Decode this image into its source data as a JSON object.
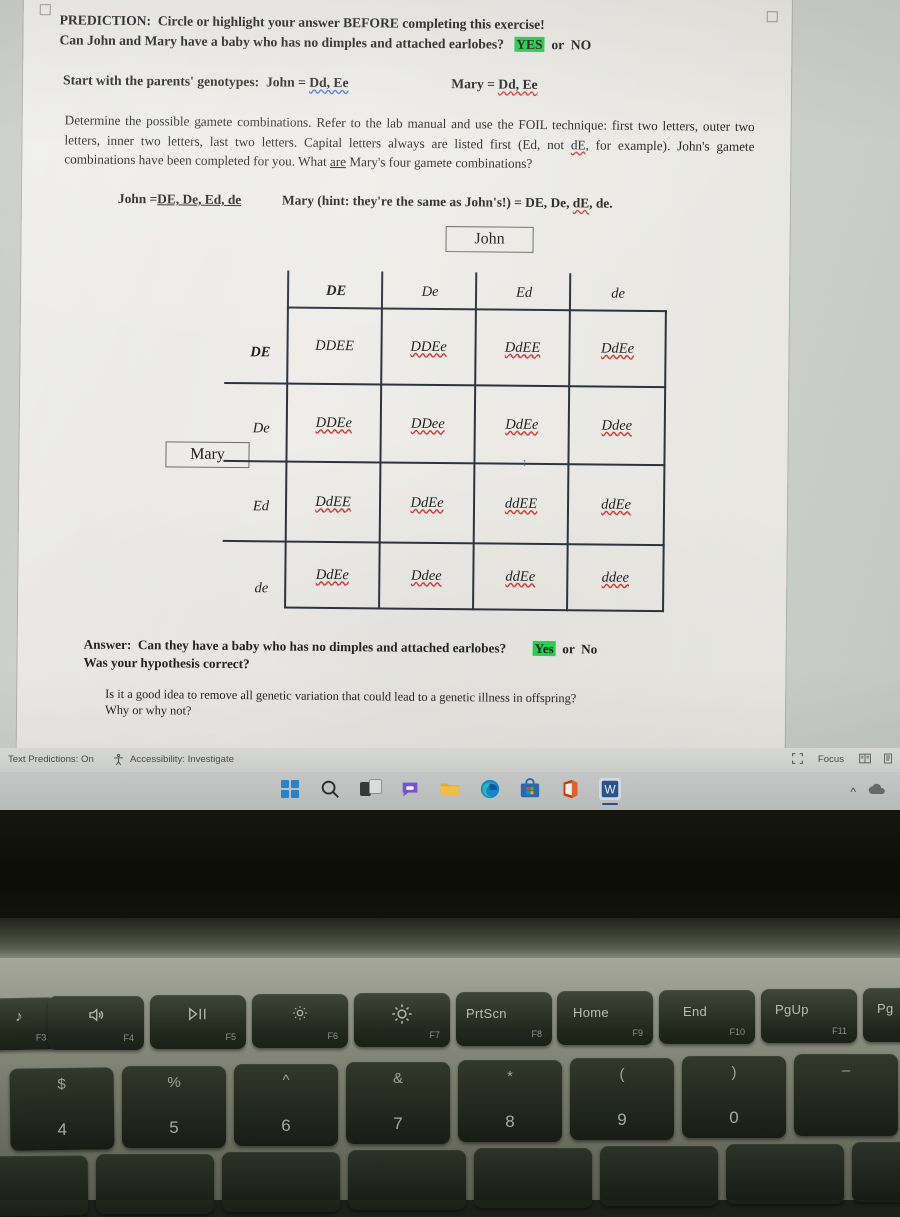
{
  "document": {
    "prediction_label": "PREDICTION:",
    "prediction_text": "Circle or highlight your answer BEFORE completing this exercise!",
    "question_line": "Can John and Mary have a baby who has no dimples and attached earlobes?",
    "answer_yes": "YES",
    "answer_or": "or",
    "answer_no": "NO",
    "genotypes_lead": "Start with the parents' genotypes:",
    "john_geno_label": "John =",
    "john_geno_value": "Dd,  Ee",
    "mary_geno_label": "Mary =",
    "mary_geno_value": "Dd,  Ee",
    "instructions": "Determine the possible gamete combinations.  Refer to the lab manual and use the FOIL technique:  first two letters, outer two letters, inner two letters, last two letters.  Capital letters always are listed first (Ed, not dE, for example).  John's gamete combinations have been completed for you.  What are Mary's four gamete combinations?",
    "instructions_part1": "Determine the possible gamete combinations.  Refer to the lab manual and use the FOIL technique:  first two letters, outer two letters, inner two letters, last two letters.  Capital letters always are listed first (Ed, not ",
    "instructions_de": "dE",
    "instructions_part2": ", for example).  John's gamete combinations have been completed for you.  What ",
    "instructions_are": "are",
    "instructions_part3": " Mary's four gamete combinations?",
    "john_gametes_label": "John =",
    "john_gametes_value": "DE, De, Ed, de",
    "mary_hint_label": "Mary (hint:  they're the same as John's!) =",
    "mary_gametes_prefix": "DE, De, ",
    "mary_gametes_de": "dE",
    "mary_gametes_suffix": ", de.",
    "answer_label": "Answer:",
    "answer_question": "Can they have a baby who has no dimples and attached earlobes?",
    "answer2_yes": "Yes",
    "answer2_or": "or",
    "answer2_no": "No",
    "hypothesis_line": "Was your hypothesis correct?",
    "reflection_line1": "Is it a good idea to remove all genetic variation that could lead to a genetic illness in offspring?",
    "reflection_line2": "Why or why not?"
  },
  "punnett": {
    "top_parent_label": "John",
    "side_parent_label": "Mary",
    "col_headers": [
      "DE",
      "De",
      "Ed",
      "de"
    ],
    "row_headers": [
      "DE",
      "De",
      "Ed",
      "de"
    ],
    "rows": [
      [
        "DDEE",
        "DDEe",
        "DdEE",
        "DdEe"
      ],
      [
        "DDEe",
        "DDee",
        "DdEe",
        "Ddee"
      ],
      [
        "DdEE",
        "DdEe",
        "ddEE",
        "ddEe"
      ],
      [
        "DdEe",
        "Ddee",
        "ddEe",
        "ddee"
      ]
    ]
  },
  "statusbar": {
    "text_predictions": "Text Predictions: On",
    "accessibility": "Accessibility: Investigate",
    "focus": "Focus",
    "view_read_icon": "read-mode-icon",
    "view_print_icon": "print-layout-icon",
    "accessibility_icon": "accessibility-person-icon",
    "focus_icon": "focus-icon"
  },
  "taskbar": {
    "items": [
      {
        "name": "start-button",
        "icon": "windows-logo-icon"
      },
      {
        "name": "search-button",
        "icon": "search-icon"
      },
      {
        "name": "task-view-button",
        "icon": "task-view-icon"
      },
      {
        "name": "chat-button",
        "icon": "chat-bubble-icon"
      },
      {
        "name": "file-explorer-button",
        "icon": "folder-icon"
      },
      {
        "name": "edge-button",
        "icon": "edge-browser-icon"
      },
      {
        "name": "microsoft-store-button",
        "icon": "store-bag-icon"
      },
      {
        "name": "office-button",
        "icon": "office-icon"
      },
      {
        "name": "word-button",
        "icon": "word-document-icon"
      }
    ],
    "tray": [
      {
        "name": "show-hidden-icons-button",
        "icon": "chevron-up-icon",
        "glyph": "∧"
      },
      {
        "name": "onedrive-button",
        "icon": "cloud-icon"
      }
    ]
  },
  "keyboard": {
    "function_row": [
      {
        "main": "",
        "sub": "F3",
        "glyph": "⦾",
        "name": "key-f3"
      },
      {
        "main": "",
        "sub": "F4",
        "glyph": "🔊",
        "name": "key-f4-volume"
      },
      {
        "main": "",
        "sub": "F5",
        "glyph": "▷❘❘",
        "name": "key-f5-play-pause"
      },
      {
        "main": "",
        "sub": "F6",
        "glyph": "☼",
        "name": "key-f6-brightness-down"
      },
      {
        "main": "",
        "sub": "F7",
        "glyph": "☀",
        "name": "key-f7-brightness-up"
      },
      {
        "main": "PrtScn",
        "sub": "F8",
        "glyph": "",
        "name": "key-f8-printscreen"
      },
      {
        "main": "Home",
        "sub": "F9",
        "glyph": "",
        "name": "key-f9-home"
      },
      {
        "main": "End",
        "sub": "F10",
        "glyph": "",
        "name": "key-f10-end"
      },
      {
        "main": "PgUp",
        "sub": "F11",
        "glyph": "",
        "name": "key-f11-pgup"
      },
      {
        "main": "Pg",
        "sub": "",
        "glyph": "",
        "name": "key-f12-pgdn"
      }
    ],
    "number_row": [
      {
        "top": "$",
        "bottom": "4",
        "name": "key-4"
      },
      {
        "top": "%",
        "bottom": "5",
        "name": "key-5"
      },
      {
        "top": "^",
        "bottom": "6",
        "name": "key-6"
      },
      {
        "top": "&",
        "bottom": "7",
        "name": "key-7"
      },
      {
        "top": "*",
        "bottom": "8",
        "name": "key-8"
      },
      {
        "top": "(",
        "bottom": "9",
        "name": "key-9"
      },
      {
        "top": ")",
        "bottom": "0",
        "name": "key-0"
      },
      {
        "top": "–",
        "bottom": "",
        "name": "key-minus"
      }
    ]
  },
  "colors": {
    "highlight_green": "#22d34a",
    "spell_red": "#d13b36",
    "grammar_blue": "#4a6fd8",
    "word_accent": "#2b579a",
    "page_bg": "#eeede9"
  }
}
